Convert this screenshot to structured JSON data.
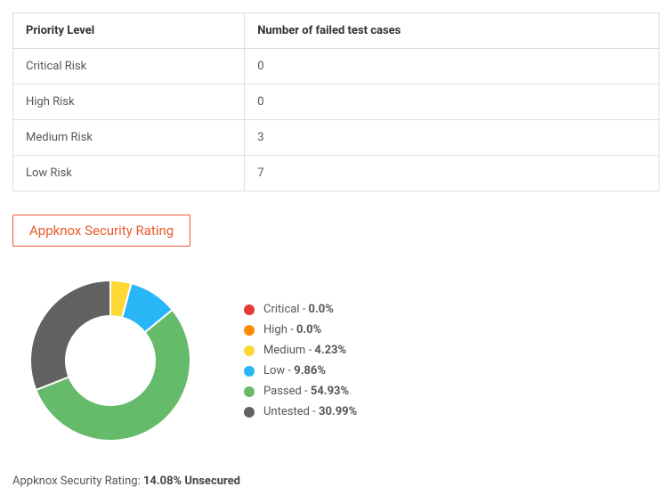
{
  "table": {
    "headers": {
      "col0": "Priority Level",
      "col1": "Number of failed test cases"
    },
    "rows": [
      {
        "level": "Critical Risk",
        "count": "0"
      },
      {
        "level": "High Risk",
        "count": "0"
      },
      {
        "level": "Medium Risk",
        "count": "3"
      },
      {
        "level": "Low Risk",
        "count": "7"
      }
    ]
  },
  "rating_box": "Appknox Security Rating",
  "chart_data": {
    "type": "pie",
    "title": "Appknox Security Rating",
    "series": [
      {
        "name": "Critical",
        "value": 0.0,
        "color": "#e53935"
      },
      {
        "name": "High",
        "value": 0.0,
        "color": "#fb8c00"
      },
      {
        "name": "Medium",
        "value": 4.23,
        "color": "#fdd835"
      },
      {
        "name": "Low",
        "value": 9.86,
        "color": "#29b6f6"
      },
      {
        "name": "Passed",
        "value": 54.93,
        "color": "#66bb6a"
      },
      {
        "name": "Untested",
        "value": 30.99,
        "color": "#616161"
      }
    ],
    "display_values": {
      "Critical": "0.0%",
      "High": "0.0%",
      "Medium": "4.23%",
      "Low": "9.86%",
      "Passed": "54.93%",
      "Untested": "30.99%"
    }
  },
  "footer": {
    "label": "Appknox Security Rating: ",
    "value": "14.08% Unsecured"
  }
}
